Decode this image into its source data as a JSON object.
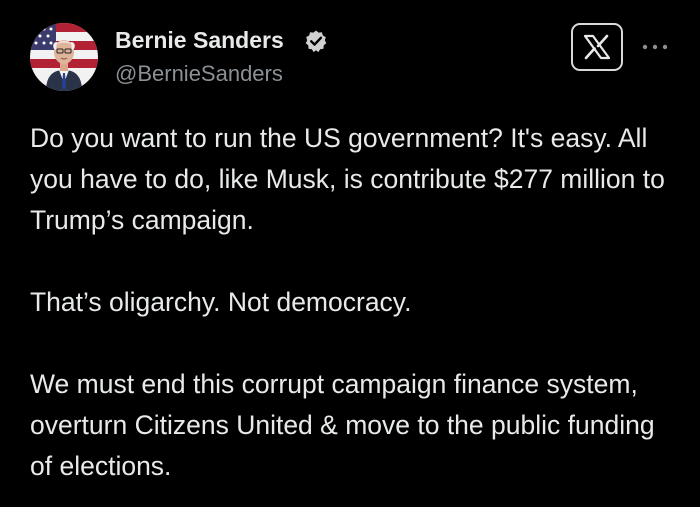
{
  "author": {
    "name": "Bernie Sanders",
    "handle": "@BernieSanders",
    "verified": true
  },
  "header": {
    "x_logo_icon": "x-logo-icon",
    "more_icon": "more-horizontal-icon"
  },
  "tweet": {
    "paragraphs": [
      "Do you want to run the US government? It's easy. All you have to do, like Musk, is contribute $277 million to Trump’s campaign.",
      "That’s oligarchy. Not democracy.",
      "We must end this corrupt campaign finance system, overturn Citizens United & move to the public funding of elections."
    ]
  },
  "colors": {
    "background": "#000000",
    "text": "#e7e9ea",
    "secondary_text": "#8b9095",
    "verified_badge": "#d0d0d0"
  }
}
